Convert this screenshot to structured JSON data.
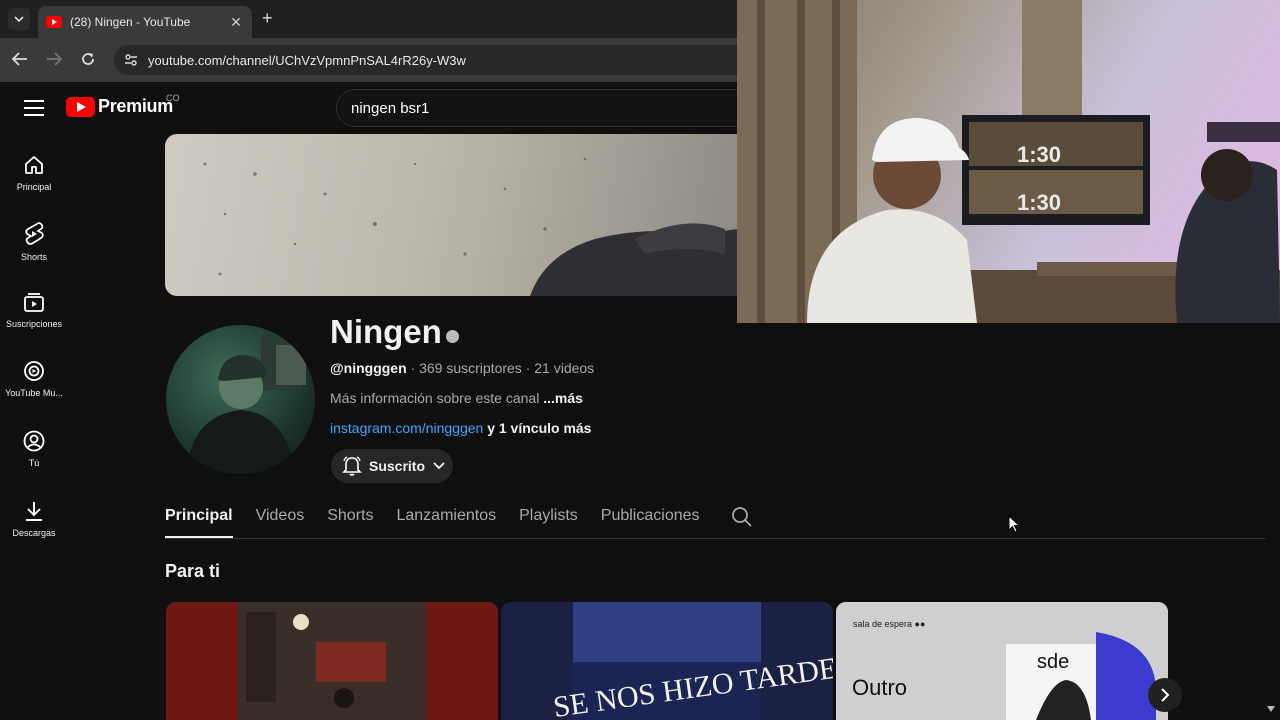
{
  "browser": {
    "tab_title": "(28) Ningen - YouTube",
    "tab_close": "✕",
    "new_tab": "+",
    "url": "youtube.com/channel/UChVzVpmnPnSAL4rR26y-W3w"
  },
  "header": {
    "logo_text": "Premium",
    "country_code": "CO",
    "search_value": "ningen  bsr1"
  },
  "sidebar": {
    "items": [
      {
        "label": "Principal",
        "icon": "home-icon"
      },
      {
        "label": "Shorts",
        "icon": "shorts-icon"
      },
      {
        "label": "Suscripciones",
        "icon": "subscriptions-icon"
      },
      {
        "label": "YouTube Mu...",
        "icon": "youtube-music-icon"
      },
      {
        "label": "Tú",
        "icon": "account-icon"
      },
      {
        "label": "Descargas",
        "icon": "download-icon"
      }
    ]
  },
  "channel": {
    "name": "Ningen",
    "handle": "@ningggen",
    "meta_rest": " · 369 suscriptores · 21 videos",
    "about_text": "Más información sobre este canal ",
    "about_more": "...más",
    "link": "instagram.com/ningggen",
    "link_more": " y 1 vínculo más",
    "subscribe_label": "Suscrito"
  },
  "tabs": [
    "Principal",
    "Videos",
    "Shorts",
    "Lanzamientos",
    "Playlists",
    "Publicaciones"
  ],
  "section_title": "Para ti",
  "cards": [
    {
      "overlay": ""
    },
    {
      "overlay": "SE NOS HIZO TARDE"
    },
    {
      "overlay_small": "sala de espera ●●",
      "overlay_big": "Outro",
      "overlay_box": "sde"
    }
  ],
  "video_overlay": {
    "scoreboard": "1:30"
  }
}
